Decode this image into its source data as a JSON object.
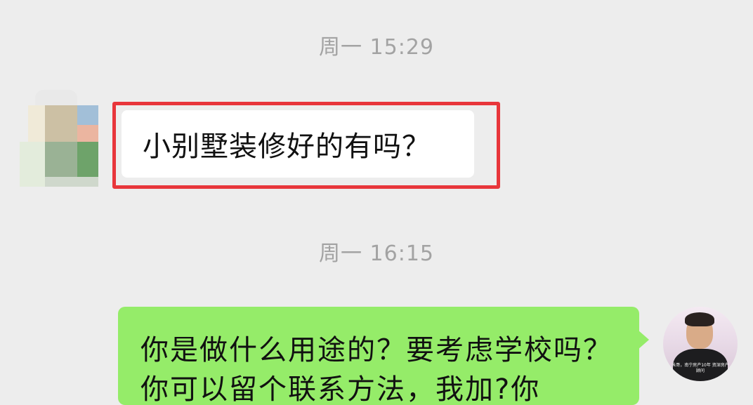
{
  "chat": {
    "timestamps": [
      "周一  15:29",
      "周一  16:15"
    ],
    "messages": [
      {
        "side": "incoming",
        "text": "小别墅装修好的有吗？"
      },
      {
        "side": "outgoing",
        "text": "你是做什么用途的？要考虑学校吗？你可以留个联系方法，我加?你"
      }
    ],
    "outgoing_avatar_caption": "朱哥，南宁房产10年 资深房产顾问"
  },
  "colors": {
    "background": "#ededed",
    "incoming_bubble": "#ffffff",
    "outgoing_bubble": "#95ec69",
    "highlight": "#e8363b",
    "timestamp_text": "#a3a3a3"
  }
}
